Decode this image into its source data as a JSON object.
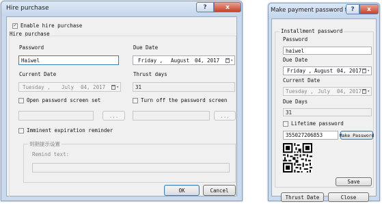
{
  "hire_dialog": {
    "title": "Hire purchase",
    "enable_checkbox": {
      "label": "Enable hire purchase",
      "checked": true
    },
    "group_title": "Hire purchase",
    "password_label": "Password",
    "password_value": "Haiwel",
    "due_date_label": "Due Date",
    "due_date": {
      "day": "Friday ,",
      "month": "August",
      "date": "04, 2017"
    },
    "current_date_label": "Current Date",
    "current_date": {
      "day": "Tuesday ,",
      "month": "July",
      "date": "04, 2017"
    },
    "thrust_days_label": "Thrust days",
    "thrust_days_value": "31",
    "open_pwd_checkbox": {
      "label": "Open password screen set",
      "checked": false
    },
    "turn_off_checkbox": {
      "label": "Turn off the password screen",
      "checked": false
    },
    "browse_label": "...",
    "imminent_checkbox": {
      "label": "Imminent expiration reminder",
      "checked": false
    },
    "reminder_group_title": "到期提示设置",
    "remind_text_label": "Remind text:",
    "ok_label": "OK",
    "cancel_label": "Cancel"
  },
  "tool_dialog": {
    "title": "Make payment password tool",
    "group_title": "Installment password",
    "password_label": "Password",
    "password_value": "haiwel",
    "due_date_label": "Due Date",
    "due_date": {
      "day": "Friday ,",
      "month": "August",
      "date": "04, 2017"
    },
    "current_date_label": "Current Date",
    "current_date": {
      "day": "Tuesday ,",
      "month": "July",
      "date": "04, 2017"
    },
    "due_days_label": "Due Days",
    "due_days_value": "31",
    "lifetime_checkbox": {
      "label": "Lifetime password",
      "checked": false
    },
    "generated_password": "355027206853",
    "make_password_label": "Make Password",
    "save_label": "Save",
    "thrust_date_label": "Thrust Date",
    "close_label": "Close"
  },
  "window_buttons": {
    "help": "?",
    "close": "x"
  },
  "icons": {
    "dropdown": "dropdown-arrow-icon",
    "calendar": "calendar-icon",
    "checkmark": "checkmark-icon",
    "qr": "qr-code"
  }
}
